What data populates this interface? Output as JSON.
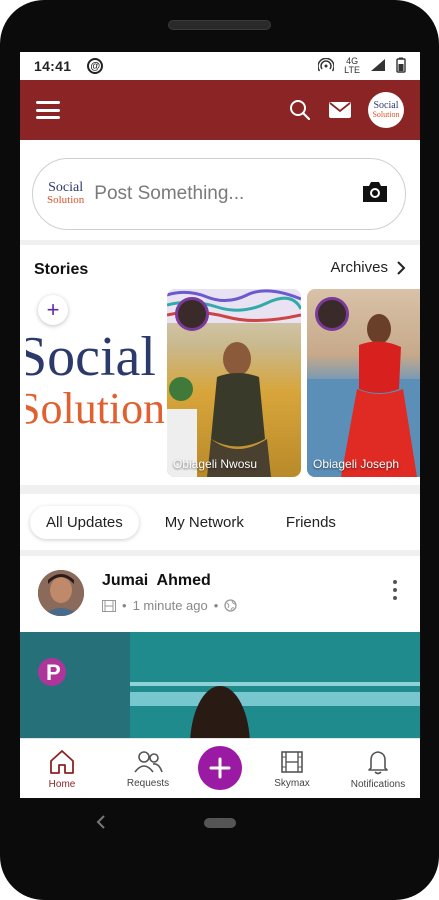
{
  "status_bar": {
    "time": "14:41",
    "network_top": "4G",
    "network_bottom": "LTE"
  },
  "app_bar": {
    "logo_line1": "Social",
    "logo_line2": "Solution"
  },
  "post_box": {
    "logo_line1": "Social",
    "logo_line2": "Solution",
    "placeholder": "Post Something..."
  },
  "stories": {
    "title": "Stories",
    "archives_label": "Archives",
    "add_logo_line1": "Social",
    "add_logo_line2": "Solution",
    "items": [
      {
        "name": "Obiageli Nwosu"
      },
      {
        "name": "Obiageli Joseph"
      }
    ]
  },
  "tabs": [
    {
      "label": "All Updates",
      "active": true
    },
    {
      "label": "My Network",
      "active": false
    },
    {
      "label": "Friends",
      "active": false
    }
  ],
  "post": {
    "author": "Jumai  Ahmed",
    "time": "1 minute ago",
    "separator": "•"
  },
  "bottom_nav": [
    {
      "label": "Home",
      "icon": "home-icon",
      "active": true
    },
    {
      "label": "Requests",
      "icon": "people-icon",
      "active": false
    },
    {
      "label": "Skymax",
      "icon": "film-icon",
      "active": false
    },
    {
      "label": "Notifications",
      "icon": "bell-icon",
      "active": false
    }
  ],
  "colors": {
    "brand": "#8b2424",
    "fab": "#9b1aa3",
    "logo_blue": "#2b3a6b",
    "logo_orange": "#e0602f"
  }
}
